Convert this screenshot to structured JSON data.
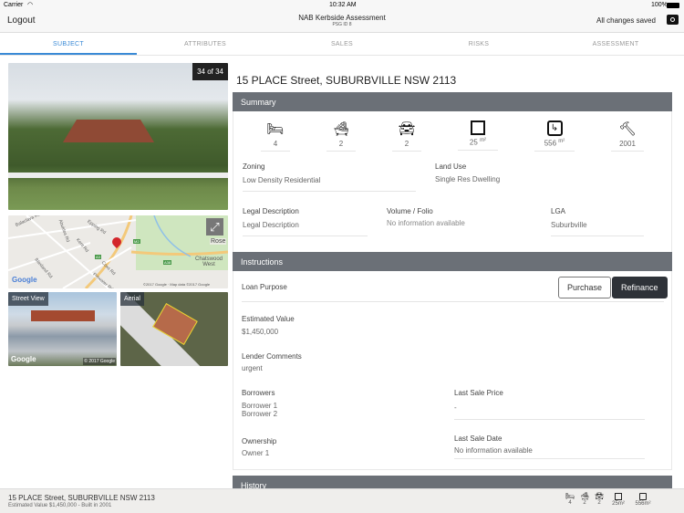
{
  "status_bar": {
    "carrier": "Carrier",
    "time": "10:32 AM",
    "battery": "100%"
  },
  "nav": {
    "logout": "Logout",
    "title": "NAB Kerbside Assessment",
    "subtitle": "PSG ID 8",
    "saved": "All changes saved"
  },
  "tabs": [
    "SUBJECT",
    "ATTRIBUTES",
    "SALES",
    "RISKS",
    "ASSESSMENT"
  ],
  "photo": {
    "counter": "34 of 34"
  },
  "map": {
    "labels": [
      "Balaclava Rd",
      "Abuklea Rd",
      "Epping Rd",
      "Kent Rd",
      "Coxs Rd",
      "Blaxland Rd",
      "Pittwater Rd",
      "Chatswood West",
      "Rose",
      "A3",
      "M2",
      "A38"
    ],
    "attribution": "©2017 Google · Map data ©2017 Google",
    "google": "Google"
  },
  "street_view": {
    "label": "Street View",
    "copyright": "© 2017 Google",
    "google": "Google"
  },
  "aerial": {
    "label": "Aerial"
  },
  "address": "15 PLACE Street, SUBURBVILLE NSW 2113",
  "summary": {
    "title": "Summary",
    "features": [
      {
        "icon": "bed-icon",
        "value": "4",
        "unit": ""
      },
      {
        "icon": "bath-icon",
        "value": "2",
        "unit": ""
      },
      {
        "icon": "car-icon",
        "value": "2",
        "unit": ""
      },
      {
        "icon": "floorplan-icon",
        "value": "25",
        "unit": "m²"
      },
      {
        "icon": "land-area-icon",
        "value": "556",
        "unit": "m²"
      },
      {
        "icon": "hammer-icon",
        "value": "2001",
        "unit": ""
      }
    ],
    "zoning_label": "Zoning",
    "zoning": "Low Density Residential",
    "land_use_label": "Land Use",
    "land_use": "Single Res Dwelling",
    "legal_label": "Legal Description",
    "legal": "Legal Description",
    "volume_label": "Volume / Folio",
    "volume": "No information available",
    "lga_label": "LGA",
    "lga": "Suburbville"
  },
  "instructions": {
    "title": "Instructions",
    "loan_purpose_label": "Loan Purpose",
    "purchase": "Purchase",
    "refinance": "Refinance",
    "est_label": "Estimated Value",
    "est": "$1,450,000",
    "comments_label": "Lender Comments",
    "comments": "urgent",
    "borrowers_label": "Borrowers",
    "borrowers": [
      "Borrower 1",
      "Borrower 2"
    ],
    "last_price_label": "Last Sale Price",
    "last_price": "-",
    "ownership_label": "Ownership",
    "ownership": "Owner 1",
    "last_date_label": "Last Sale Date",
    "last_date": "No information available"
  },
  "history": {
    "title": "History"
  },
  "bottom": {
    "address": "15 PLACE Street, SUBURBVILLE NSW 2113",
    "subtitle": "Estimated Value $1,450,000 - Built in 2001",
    "stats": [
      "4",
      "2",
      "2",
      "25m²",
      "556m²"
    ]
  },
  "colors": {
    "accent": "#3a8ad6",
    "section_header": "#6b7077",
    "dark_button": "#2e3238"
  }
}
